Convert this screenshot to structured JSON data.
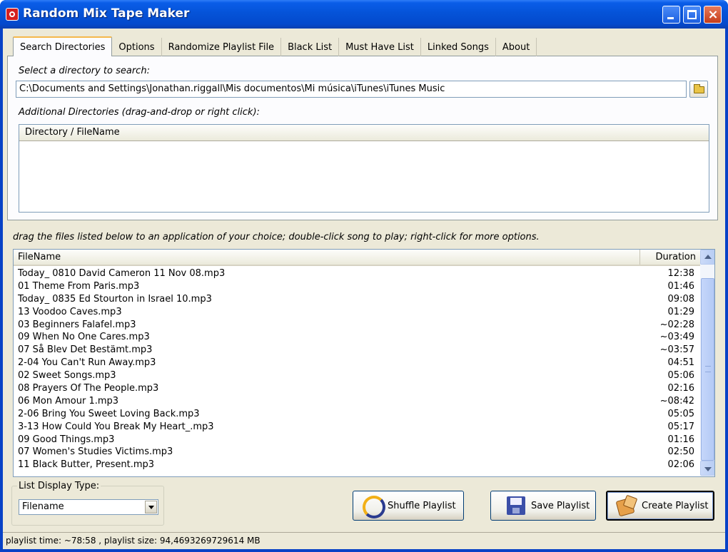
{
  "window": {
    "title": "Random Mix Tape Maker",
    "close_glyph": "×"
  },
  "tabs": [
    {
      "label": "Search Directories",
      "active": true
    },
    {
      "label": "Options"
    },
    {
      "label": "Randomize Playlist File"
    },
    {
      "label": "Black List"
    },
    {
      "label": "Must Have List"
    },
    {
      "label": "Linked Songs"
    },
    {
      "label": "About"
    }
  ],
  "search": {
    "select_label": "Select a directory to search:",
    "directory": "C:\\Documents and Settings\\Jonathan.riggall\\Mis documentos\\Mi música\\iTunes\\iTunes Music",
    "browse_icon": "folder-icon",
    "additional_label": "Additional Directories (drag-and-drop or right click):",
    "dir_column": "Directory / FileName"
  },
  "files": {
    "hint": "drag the files listed below to an application of your choice; double-click song to play; right-click for more options.",
    "col_name": "FileName",
    "col_duration": "Duration",
    "rows": [
      {
        "name": "Today_ 0810 David Cameron 11 Nov 08.mp3",
        "duration": "12:38"
      },
      {
        "name": "01 Theme From Paris.mp3",
        "duration": "01:46"
      },
      {
        "name": "Today_ 0835 Ed Stourton in Israel 10.mp3",
        "duration": "09:08"
      },
      {
        "name": "13 Voodoo Caves.mp3",
        "duration": "01:29"
      },
      {
        "name": "03 Beginners Falafel.mp3",
        "duration": "~02:28"
      },
      {
        "name": "09 When No One Cares.mp3",
        "duration": "~03:49"
      },
      {
        "name": "07 Så Blev Det Bestämt.mp3",
        "duration": "~03:57"
      },
      {
        "name": "2-04 You Can't Run Away.mp3",
        "duration": "04:51"
      },
      {
        "name": "02 Sweet Songs.mp3",
        "duration": "05:06"
      },
      {
        "name": "08 Prayers Of The People.mp3",
        "duration": "02:16"
      },
      {
        "name": "06 Mon Amour 1.mp3",
        "duration": "~08:42"
      },
      {
        "name": "2-06 Bring You Sweet Loving Back.mp3",
        "duration": "05:05"
      },
      {
        "name": "3-13 How Could You Break My Heart_.mp3",
        "duration": "05:17"
      },
      {
        "name": "09 Good Things.mp3",
        "duration": "01:16"
      },
      {
        "name": "07 Women's Studies Victims.mp3",
        "duration": "02:50"
      },
      {
        "name": "11 Black Butter, Present.mp3",
        "duration": "02:06"
      }
    ]
  },
  "display": {
    "group_label": "List Display Type:",
    "selected": "Filename"
  },
  "buttons": {
    "shuffle": "Shuffle Playlist",
    "save": "Save Playlist",
    "create": "Create Playlist"
  },
  "status": {
    "text": "playlist time: ~78:58 , playlist size: 94,4693269729614 MB"
  },
  "colors": {
    "titlebar": "#0553d8",
    "face": "#ece9d8",
    "active_tab_accent": "#f5b84b"
  }
}
